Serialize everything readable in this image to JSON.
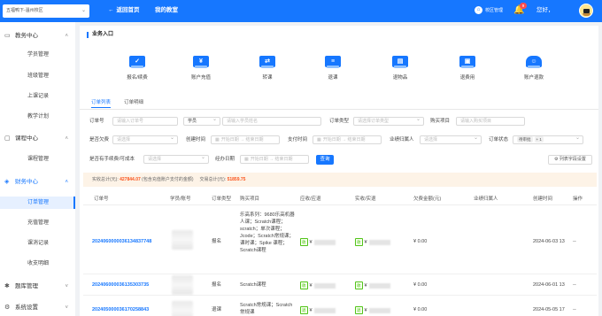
{
  "header": {
    "school_selector": "五福鸭下-温州校区",
    "back_home": "返回首页",
    "my_desk": "我的教室",
    "campus_mgmt": "校区管理",
    "notification_count": "9",
    "greeting": "您好，",
    "brand_color": "#1677ff"
  },
  "sidebar": {
    "groups": [
      {
        "label": "教务中心",
        "icon": "home-icon"
      },
      {
        "label": "课程中心",
        "icon": "book-icon"
      },
      {
        "label": "财务中心",
        "icon": "finance-icon"
      },
      {
        "label": "题库管理",
        "icon": "gear-icon"
      },
      {
        "label": "系统设置",
        "icon": "settings-icon"
      }
    ],
    "items": [
      "学员管理",
      "班级管理",
      "上课记录",
      "教学计划",
      "课程管理",
      "订单管理",
      "充值管理",
      "课消记录",
      "收支明细"
    ]
  },
  "main": {
    "section_title": "业务入口",
    "entries": [
      {
        "label": "报名/续费",
        "icon": "check-icon"
      },
      {
        "label": "账户充值",
        "icon": "yen-icon"
      },
      {
        "label": "转课",
        "icon": "transfer-icon"
      },
      {
        "label": "退课",
        "icon": "return-icon"
      },
      {
        "label": "退物品",
        "icon": "goods-icon"
      },
      {
        "label": "退费用",
        "icon": "refund-icon"
      },
      {
        "label": "账户退款",
        "icon": "account-refund-icon"
      }
    ],
    "tabs": [
      "订单列表",
      "订单明细"
    ]
  },
  "filters": {
    "order_no_label": "订单号",
    "order_no_placeholder": "请输入订单号",
    "student_select": "学员",
    "student_placeholder": "请输入学员姓名",
    "order_type_label": "订单类型",
    "order_type_placeholder": "请选择订单类型",
    "course_label": "购买项目",
    "course_placeholder": "请输入购买项目",
    "owe_label": "是否欠费",
    "owe_placeholder": "请选择",
    "create_time_label": "创建时间",
    "pay_time_label": "支付时间",
    "start_date": "开始日期",
    "end_date": "结束日期",
    "performer_label": "业绩归属人",
    "performer_placeholder": "请选择",
    "status_label": "订单状态",
    "status_tag": "待审批",
    "status_more": "+ 1",
    "handfee_label": "是否有手续费/可成本",
    "handfee_placeholder": "请选择",
    "handle_date_label": "经办日期",
    "query_button": "查询",
    "columns_button": "列表字段设置"
  },
  "summary": {
    "actual_label": "实收总计(元):",
    "actual_value": "427844.07",
    "actual_note": "(包含充值账户支付的金额)",
    "deal_label": "交易总计(元):",
    "deal_value": "51859.75"
  },
  "table": {
    "columns": [
      "订单号",
      "学员/账号",
      "订单类型",
      "购买项目",
      "应收/应退",
      "实收/实退",
      "欠费金额(元)",
      "业绩归属人",
      "创建时间",
      "操作"
    ],
    "rows": [
      {
        "order_no": "20240600000361348377​48",
        "type": "报名",
        "items": "乐高系列：9680乐高机器人课；Scratch课程；scratch；单次课程；Jcode；Scratch常规课；课时课；Spike 课程；Scratch课程",
        "recv_tag": "收",
        "recv_prefix": "¥",
        "paid_tag": "收",
        "paid_prefix": "¥",
        "owe": "¥ 0.00",
        "created": "2024-06-03 13",
        "op": "--"
      },
      {
        "order_no": "202406000036135303735",
        "type": "报名",
        "items": "Scratch课程",
        "recv_tag": "收",
        "recv_prefix": "¥",
        "paid_tag": "收",
        "paid_prefix": "¥",
        "owe": "¥ 0.00",
        "created": "2024-06-01 13",
        "op": "--"
      },
      {
        "order_no": "202405000036170258843",
        "type": "退课",
        "items": "Scratch常规课；Scratch常规课",
        "recv_tag": "退",
        "recv_prefix": "¥",
        "paid_tag": "退",
        "paid_prefix": "¥",
        "owe": "¥ 0.00",
        "created": "2024-05-05 17",
        "op": "--"
      }
    ]
  }
}
